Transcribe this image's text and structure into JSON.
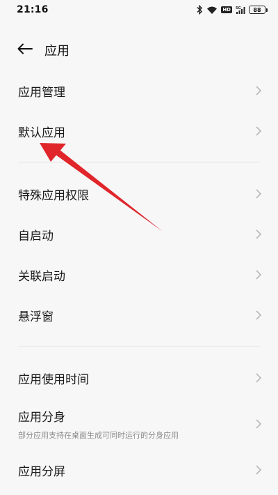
{
  "status_bar": {
    "time": "21:16",
    "network_badge": "HD",
    "signal_label": "5G",
    "battery": "88"
  },
  "header": {
    "title": "应用",
    "back_icon": "arrow-left-icon"
  },
  "menu": {
    "items": [
      {
        "label": "应用管理"
      },
      {
        "label": "默认应用"
      },
      {
        "label": "特殊应用权限"
      },
      {
        "label": "自启动"
      },
      {
        "label": "关联启动"
      },
      {
        "label": "悬浮窗"
      },
      {
        "label": "应用使用时间"
      },
      {
        "label": "应用分身",
        "subtitle": "部分应用支持在桌面生成可同时运行的分身应用"
      },
      {
        "label": "应用分屏"
      }
    ]
  },
  "colors": {
    "background": "#f7f7f7",
    "chevron": "#b8b8b8",
    "annotation_arrow": "#e0262b"
  }
}
